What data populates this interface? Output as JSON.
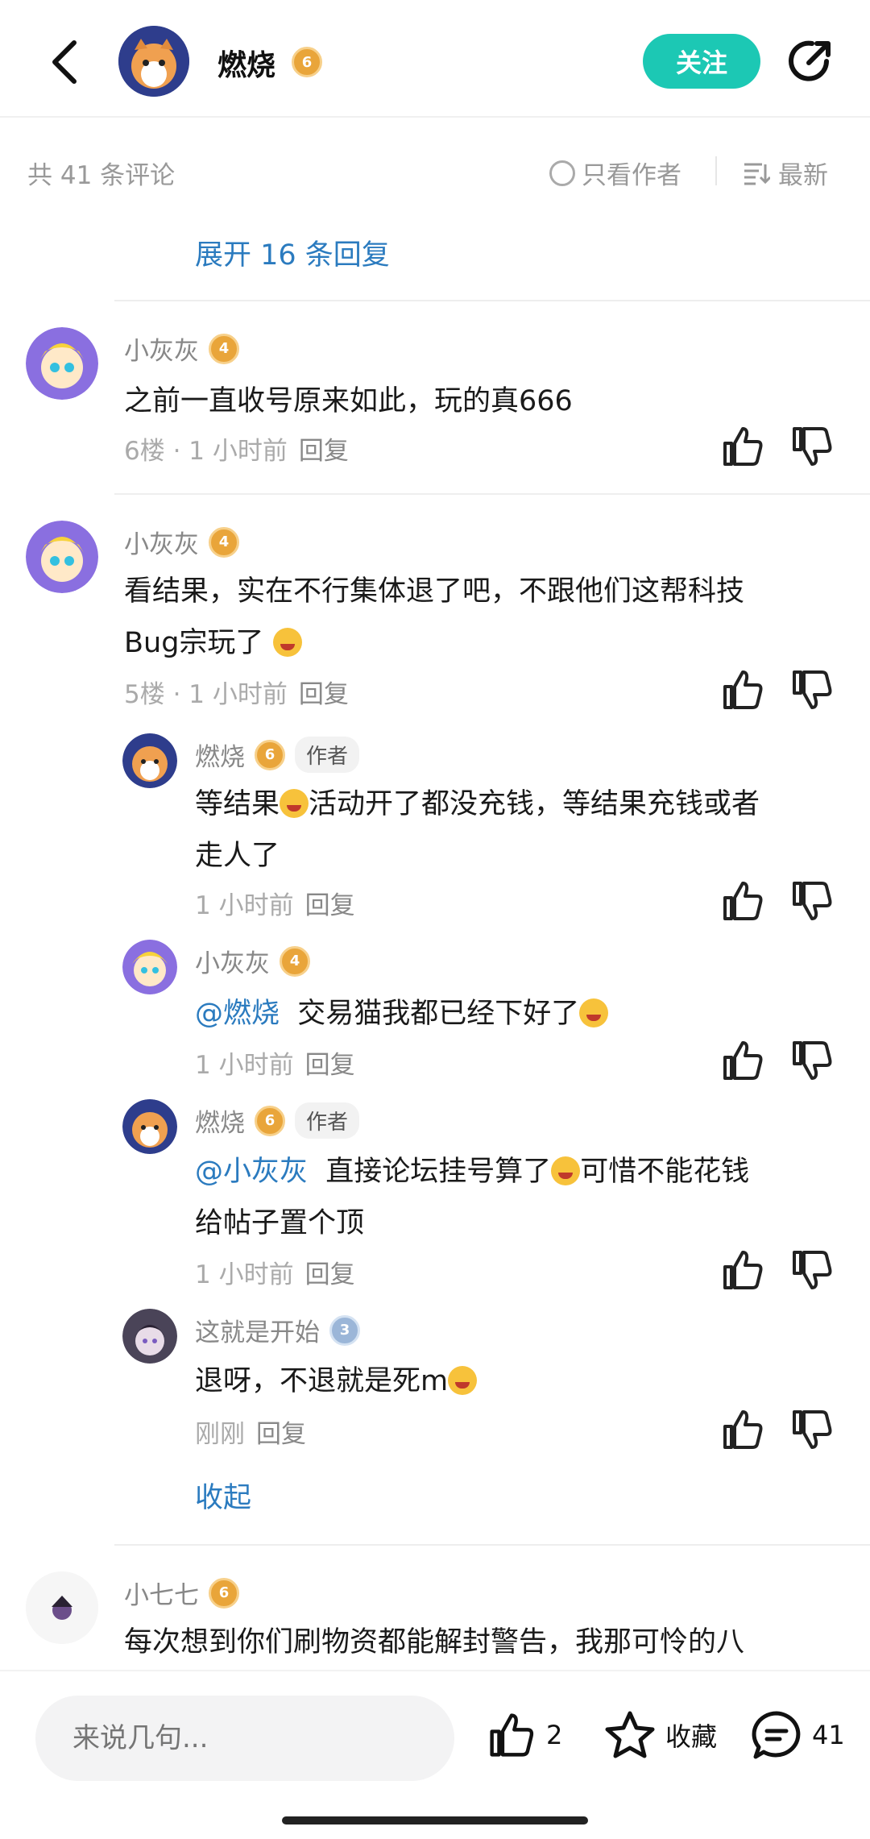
{
  "header": {
    "user_name": "燃烧",
    "level": "6",
    "follow_label": "关注"
  },
  "sortbar": {
    "comment_count": "共 41 条评论",
    "author_only": "只看作者",
    "latest": "最新"
  },
  "expand_label": "展开 16 条回复",
  "collapse_label": "收起",
  "comments": [
    {
      "user": "小灰灰",
      "level": "4",
      "text": "之前一直收号原来如此，玩的真666",
      "floor": "6楼",
      "time": "1 小时前",
      "reply": "回复"
    },
    {
      "user": "小灰灰",
      "level": "4",
      "text_line1": "看结果，实在不行集体退了吧，不跟他们这帮科技",
      "text_line2": "Bug宗玩了",
      "floor": "5楼",
      "time": "1 小时前",
      "reply": "回复"
    }
  ],
  "replies": [
    {
      "user": "燃烧",
      "level": "6",
      "tag": "作者",
      "text_a": "等结果",
      "text_b": "活动开了都没充钱，等结果充钱或者",
      "text_line2": "走人了",
      "time": "1 小时前",
      "reply": "回复"
    },
    {
      "user": "小灰灰",
      "level": "4",
      "mention": "@燃烧",
      "text": "交易猫我都已经下好了",
      "time": "1 小时前",
      "reply": "回复"
    },
    {
      "user": "燃烧",
      "level": "6",
      "tag": "作者",
      "mention": "@小灰灰",
      "text": "直接论坛挂号算了",
      "text_b": "可惜不能花钱",
      "text_line2": "给帖子置个顶",
      "time": "1 小时前",
      "reply": "回复"
    },
    {
      "user": "这就是开始",
      "level": "3",
      "text": "退呀，不退就是死m",
      "time": "刚刚",
      "reply": "回复"
    }
  ],
  "next_comment": {
    "user": "小七七",
    "level": "6",
    "text": "每次想到你们刷物资都能解封警告，我那可怜的八"
  },
  "bottom": {
    "input_placeholder": "来说几句...",
    "like_count": "2",
    "favorite_label": "收藏",
    "comment_count": "41"
  },
  "colors": {
    "accent": "#1cc8b4",
    "link": "#2b7bbf",
    "badge": "#e9a53a"
  }
}
